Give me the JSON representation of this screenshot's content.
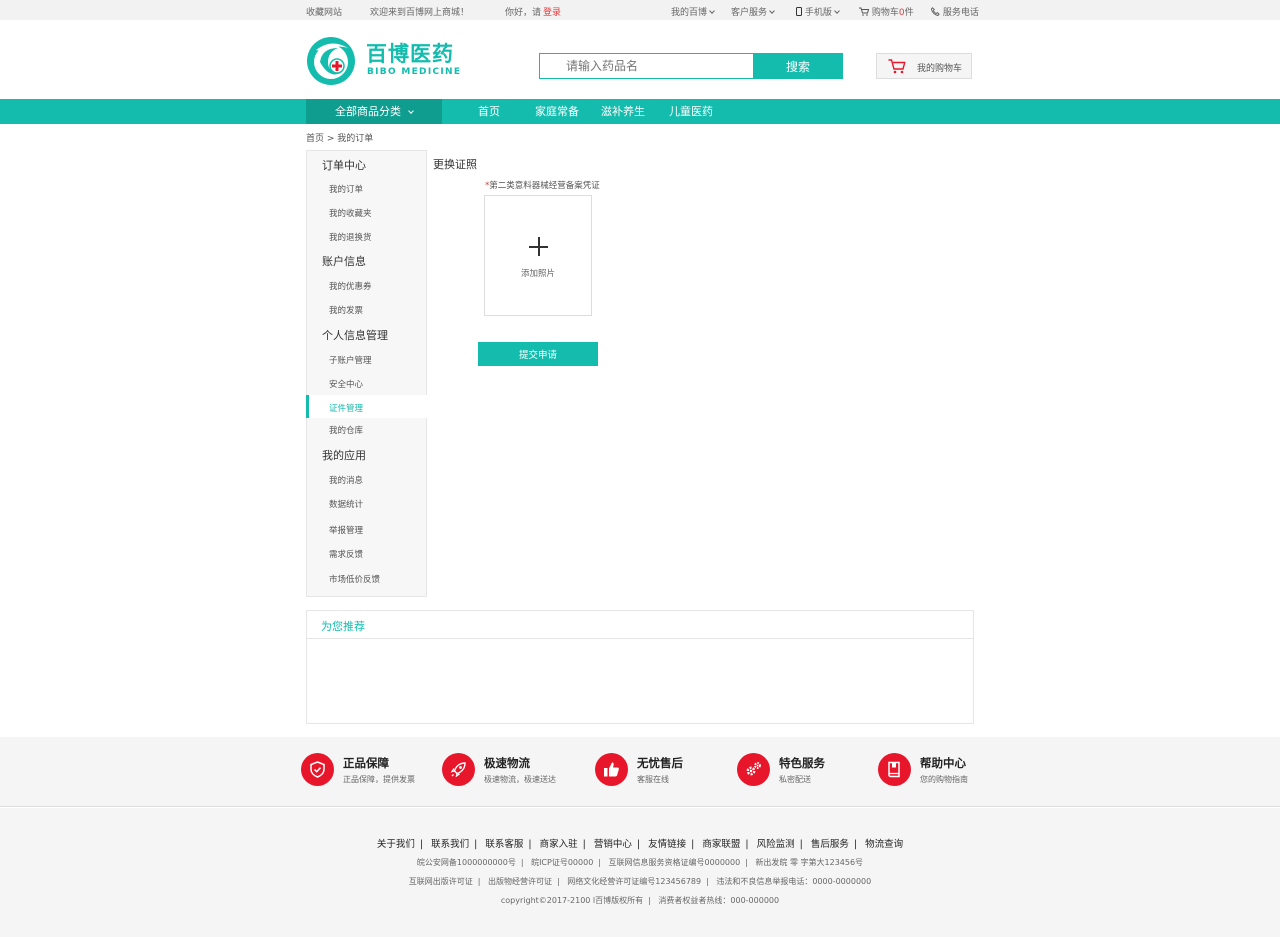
{
  "topbar": {
    "fav": "收藏网站",
    "welcome": "欢迎来到百博网上商城！",
    "hello": "你好，请",
    "login": "登录",
    "my_bibo": "我的百博",
    "customer_service": "客户服务",
    "mobile": "手机版",
    "cart_prefix": "购物车",
    "cart_count": "0",
    "cart_suffix": "件",
    "hotline": "服务电话"
  },
  "header": {
    "logo_cn": "百博医药",
    "logo_en": "BIBO MEDICINE",
    "search_placeholder": "请输入药品名",
    "search_button": "搜索",
    "cart_label": "我的购物车"
  },
  "nav": {
    "all_categories": "全部商品分类",
    "items": [
      "首页",
      "家庭常备",
      "滋补养生",
      "儿童医药"
    ]
  },
  "breadcrumb": "首页 > 我的订单",
  "sidebar": {
    "groups": [
      {
        "title": "订单中心",
        "items": [
          "我的订单",
          "我的收藏夹",
          "我的退换货"
        ]
      },
      {
        "title": "账户信息",
        "items": [
          "我的优惠券",
          "我的发票"
        ]
      },
      {
        "title": "个人信息管理",
        "items": [
          "子账户管理",
          "安全中心",
          "证件管理",
          "我的仓库"
        ]
      },
      {
        "title": "我的应用",
        "items": [
          "我的消息",
          "数据统计",
          "举报管理",
          "需求反馈",
          "市场低价反馈"
        ]
      }
    ],
    "active_item": "证件管理"
  },
  "main": {
    "title": "更换证照",
    "required_mark": "*",
    "field_label": "第二类意料器械经营备案凭证",
    "upload_text": "添加照片",
    "submit": "提交申请"
  },
  "recommend": {
    "title": "为您推荐"
  },
  "features": [
    {
      "title": "正品保障",
      "sub": "正品保障，提供发票",
      "icon": "shield-icon"
    },
    {
      "title": "极速物流",
      "sub": "极速物流，极速送达",
      "icon": "rocket-icon"
    },
    {
      "title": "无忧售后",
      "sub": "客服在线",
      "icon": "thumbs-up-icon"
    },
    {
      "title": "特色服务",
      "sub": "私密配送",
      "icon": "gears-icon"
    },
    {
      "title": "帮助中心",
      "sub": "您的购物指南",
      "icon": "book-icon"
    }
  ],
  "footer": {
    "links": [
      "关于我们",
      "联系我们",
      "联系客服",
      "商家入驻",
      "营销中心",
      "友情链接",
      "商家联盟",
      "风险监测",
      "售后服务",
      "物流查询"
    ],
    "line1": [
      "皖公安网备1000000000号",
      "皖ICP证号00000",
      "互联网信息服务资格证编号0000000",
      "新出发皖 零  字第大123456号"
    ],
    "line2": [
      "互联网出版许可证",
      "出版物经营许可证",
      "网络文化经营许可证编号123456789",
      "违法和不良信息举报电话：0000-0000000"
    ],
    "line3": [
      "copyright©2017-2100  l百博版权所有",
      "消费者权益者热线：000-000000"
    ]
  },
  "colors": {
    "accent": "#14bcae",
    "accent_dark": "#0f9d8f",
    "feature_red": "#e8162a",
    "login_red": "#e4393c"
  }
}
